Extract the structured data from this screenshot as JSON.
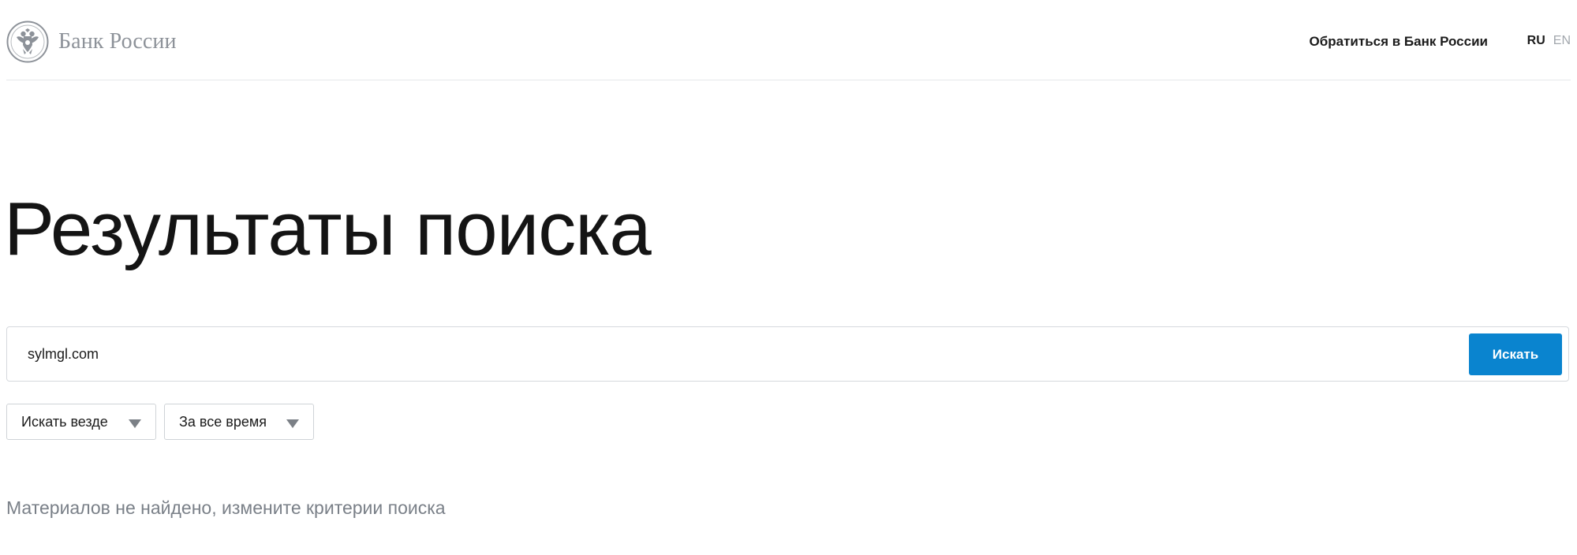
{
  "header": {
    "brand_name": "Банк России",
    "contact_link": "Обратиться в Банк России",
    "languages": {
      "active": "RU",
      "other": "EN"
    }
  },
  "page": {
    "title": "Результаты поиска"
  },
  "search": {
    "query": "sylmgl.com",
    "button_label": "Искать"
  },
  "filters": {
    "scope": "Искать везде",
    "period": "За все время"
  },
  "results": {
    "empty_message": "Материалов не найдено, измените критерии поиска"
  },
  "icons": {
    "emblem": "bank-of-russia-eagle-emblem",
    "dropdown": "caret-down-icon"
  },
  "colors": {
    "accent": "#0a84cf",
    "muted_text": "#7a8088",
    "brand_text": "#8d9299"
  }
}
